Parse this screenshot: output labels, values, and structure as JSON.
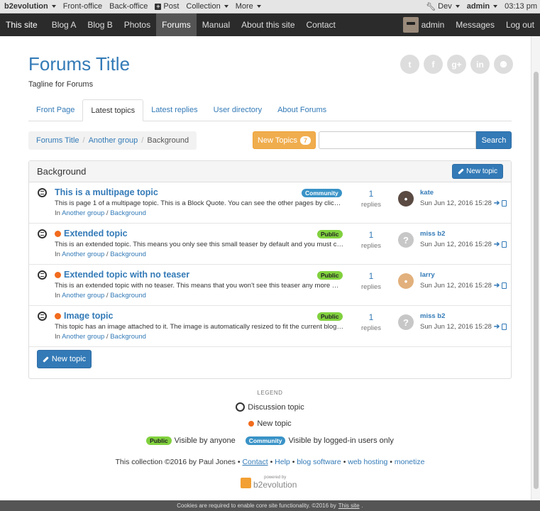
{
  "adminbar": {
    "brand": "b2evolution",
    "items": [
      "Front-office",
      "Back-office",
      "Post",
      "Collection",
      "More"
    ],
    "dev": "Dev",
    "user": "admin",
    "time": "03:13 pm"
  },
  "sitenav": {
    "items": [
      "This site",
      "Blog A",
      "Blog B",
      "Photos",
      "Forums",
      "Manual",
      "About this site",
      "Contact"
    ],
    "active": "Forums",
    "right": {
      "user": "admin",
      "messages": "Messages",
      "logout": "Log out"
    }
  },
  "page": {
    "title": "Forums Title",
    "tagline": "Tagline for Forums"
  },
  "social_icons": [
    "twitter-icon",
    "facebook-icon",
    "google-plus-icon",
    "linkedin-icon",
    "github-icon"
  ],
  "tabs": [
    "Front Page",
    "Latest topics",
    "Latest replies",
    "User directory",
    "About Forums"
  ],
  "breadcrumb": {
    "items": [
      "Forums Title",
      "Another group"
    ],
    "current": "Background"
  },
  "toolbar": {
    "new_topics_label": "New Topics",
    "new_topics_count": "7",
    "search_placeholder": "",
    "search_label": "Search"
  },
  "panel": {
    "title": "Background",
    "new_topic_label": "New topic",
    "topics": [
      {
        "title": "This is a multipage topic",
        "new": false,
        "visibility": "Community",
        "excerpt": "This is page 1 of a multipage topic. This is a Block Quote. You can see the other pages by clicking on the links below the post.",
        "in": "In",
        "group": "Another group",
        "cat": "Background",
        "count": "1",
        "count_label": "replies",
        "user": "kate",
        "date": "Sun Jun 12, 2016 15:28"
      },
      {
        "title": "Extended topic",
        "new": true,
        "visibility": "Public",
        "excerpt": "This is an extended topic. This means you only see this small teaser by default and you must click on the link below to see more.",
        "in": "In",
        "group": "Another group",
        "cat": "Background",
        "count": "1",
        "count_label": "replies",
        "user": "miss b2",
        "date": "Sun Jun 12, 2016 15:28"
      },
      {
        "title": "Extended topic with no teaser",
        "new": true,
        "visibility": "Public",
        "excerpt": "This is an extended topic with no teaser. This means that you won't see this teaser any more when you click the link below.",
        "in": "In",
        "group": "Another group",
        "cat": "Background",
        "count": "1",
        "count_label": "replies",
        "user": "larry",
        "date": "Sun Jun 12, 2016 15:28"
      },
      {
        "title": "Image topic",
        "new": true,
        "visibility": "Public",
        "excerpt": "This topic has an image attached to it. The image is automatically resized to fit the current blog skin. You can zoom in.",
        "in": "In",
        "group": "Another group",
        "cat": "Background",
        "count": "1",
        "count_label": "replies",
        "user": "miss b2",
        "date": "Sun Jun 12, 2016 15:28"
      }
    ],
    "new_topic_big_label": "New topic"
  },
  "legend": {
    "title": "LEGEND",
    "discussion": "Discussion topic",
    "new": "New topic",
    "public_badge": "Public",
    "public_text": "Visible by anyone",
    "community_badge": "Community",
    "community_text": "Visible by logged-in users only"
  },
  "footer": {
    "text": "This collection ©2016 by Paul Jones",
    "links": [
      "Contact",
      "Help",
      "blog software",
      "web hosting",
      "monetize"
    ],
    "sep": "•",
    "powered_small": "powered by",
    "powered_big": "b2evolution"
  },
  "cookie": {
    "text": "Cookies are required to enable core site functionality. ©2016 by",
    "link": "This site",
    "end": "."
  },
  "colors": {
    "accent": "#337ab7",
    "warning": "#f0ad4e",
    "new_dot": "#f26b1d",
    "public": "#81d13e",
    "community": "#3a93c7"
  }
}
